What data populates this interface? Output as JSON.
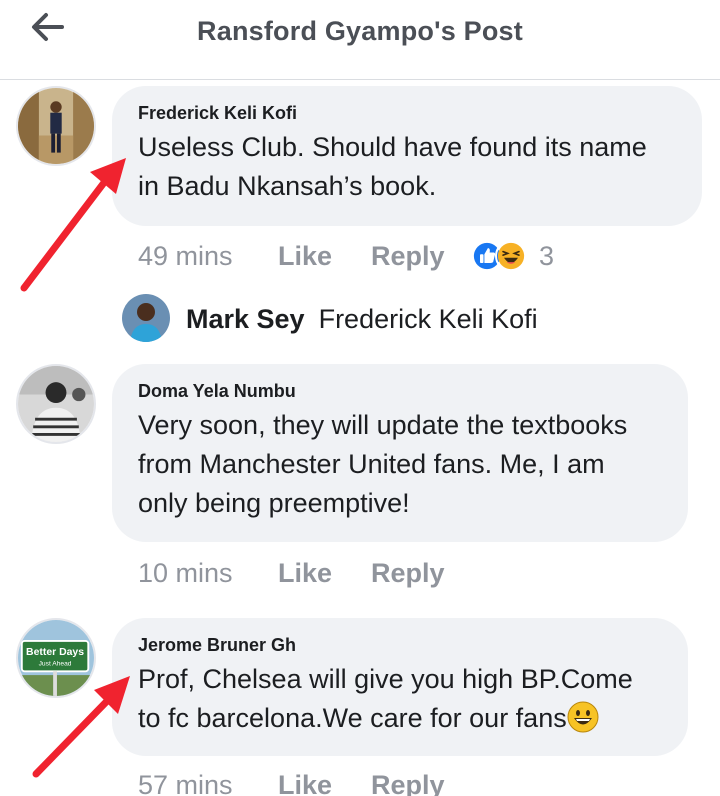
{
  "header": {
    "title": "Ransford Gyampo's Post",
    "back_icon": "arrow-left-icon"
  },
  "comments": [
    {
      "author": "Frederick Keli Kofi",
      "text_lines": [
        "Useless Club. Should have found its name",
        "in Badu Nkansah’s book."
      ],
      "time": "49 mins",
      "like_label": "Like",
      "reply_label": "Reply",
      "reactions": [
        "like-reaction-icon",
        "haha-reaction-icon"
      ],
      "reaction_count": "3"
    },
    {
      "author": "Doma Yela Numbu",
      "text_lines": [
        "Very soon, they will update the textbooks",
        "from Manchester United fans. Me, I am",
        "only being preemptive!"
      ],
      "time": "10 mins",
      "like_label": "Like",
      "reply_label": "Reply"
    },
    {
      "author": "Jerome Bruner Gh",
      "text_lines": [
        "Prof, Chelsea will give you high BP.Come",
        "to fc barcelona.We care for our fans"
      ],
      "emoji": "😀",
      "time": "57 mins",
      "like_label": "Like",
      "reply_label": "Reply",
      "avatar_text": [
        "Better Days",
        "Just Ahead"
      ]
    }
  ],
  "reply_preview": {
    "name": "Mark Sey",
    "text": "Frederick Keli Kofi"
  },
  "colors": {
    "bubble": "#f0f2f5",
    "meta_text": "#90949c",
    "annotation_arrow": "#f0232f",
    "like_blue": "#1877f2"
  }
}
